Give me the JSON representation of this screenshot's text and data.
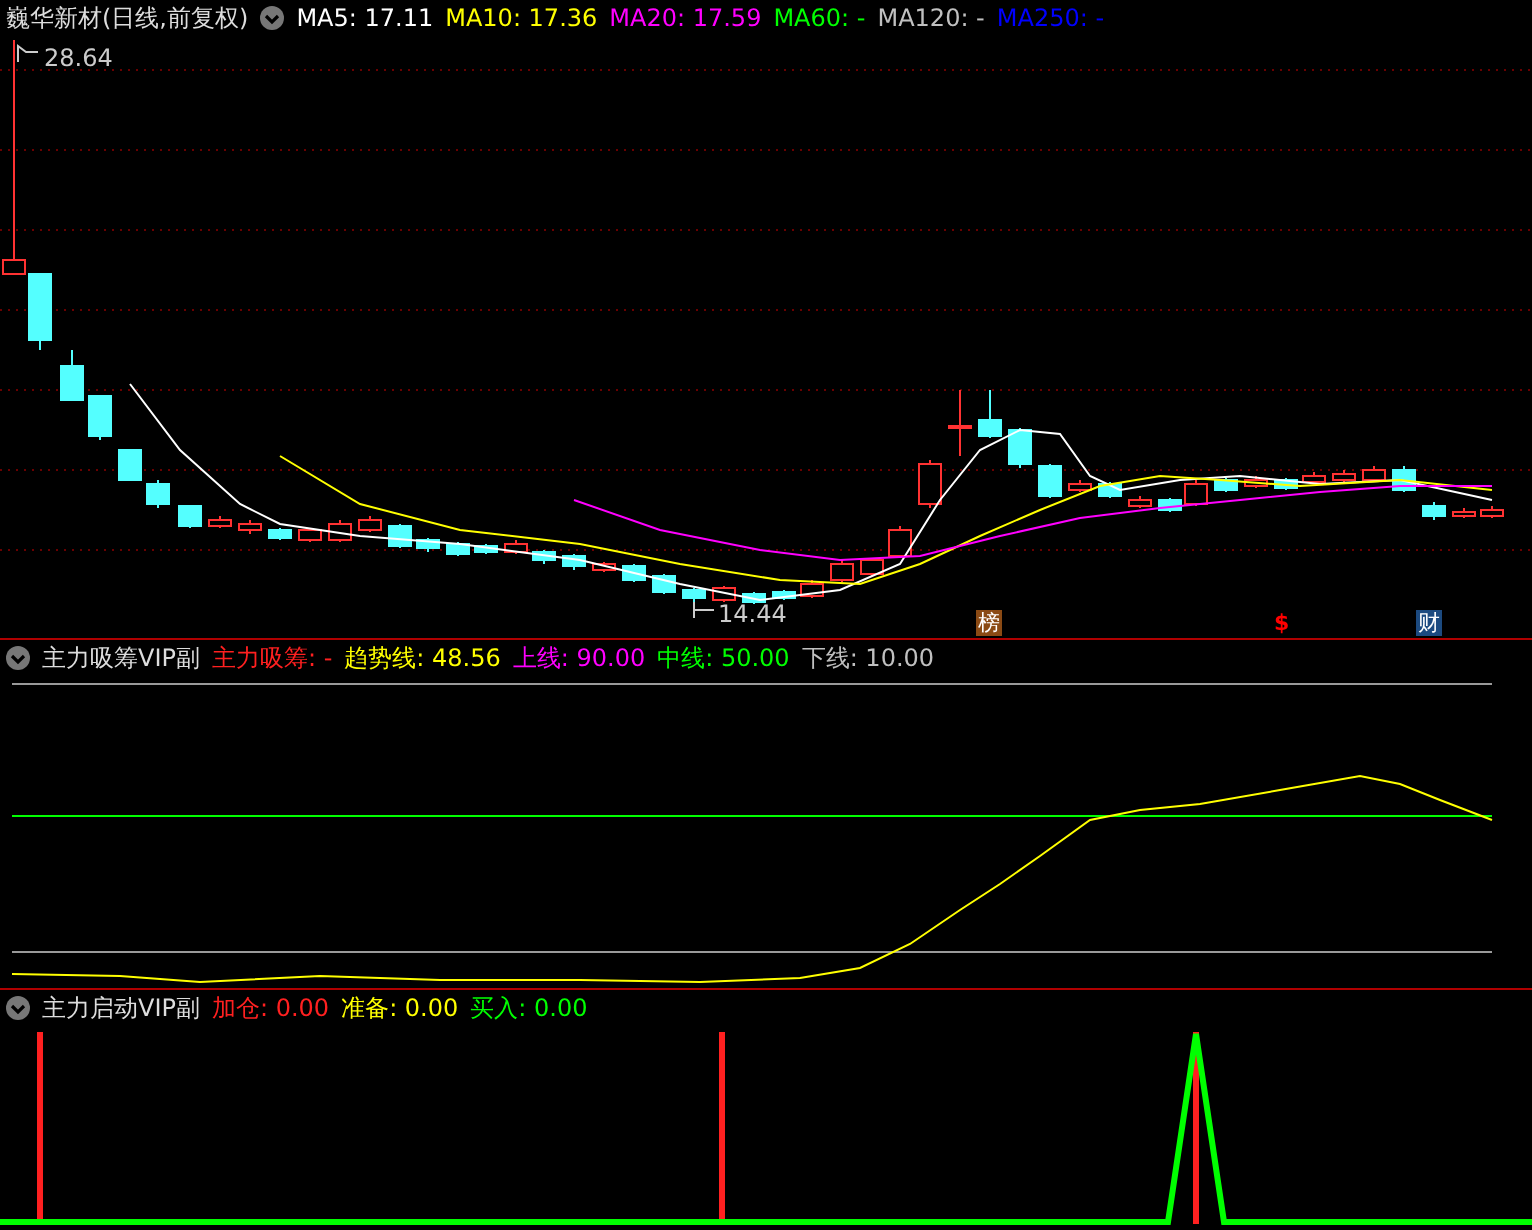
{
  "main_panel": {
    "title": "巍华新材(日线,前复权)",
    "legends": [
      {
        "label": "MA5: 17.11",
        "color": "#ffffff"
      },
      {
        "label": "MA10: 17.36",
        "color": "#ffff00"
      },
      {
        "label": "MA20: 17.59",
        "color": "#ff00ff"
      },
      {
        "label": "MA60: -",
        "color": "#00ff00"
      },
      {
        "label": "MA120: -",
        "color": "#c0c0c0"
      },
      {
        "label": "MA250: -",
        "color": "#0000ff"
      }
    ],
    "high_label": "28.64",
    "low_label": "14.44",
    "markers": [
      {
        "text": "榜",
        "color": "#8b4a14"
      },
      {
        "text": "$",
        "color": "#ff0000"
      },
      {
        "text": "财",
        "color": "#1c4a80"
      }
    ]
  },
  "indicator_panels": [
    {
      "title": "主力吸筹VIP副",
      "legends": [
        {
          "label": "主力吸筹: -",
          "color": "#ff2020"
        },
        {
          "label": "趋势线: 48.56",
          "color": "#ffff00"
        },
        {
          "label": "上线: 90.00",
          "color": "#ff00ff"
        },
        {
          "label": "中线: 50.00",
          "color": "#00ff00"
        },
        {
          "label": "下线: 10.00",
          "color": "#c0c0c0"
        }
      ]
    },
    {
      "title": "主力启动VIP副",
      "legends": [
        {
          "label": "加仓: 0.00",
          "color": "#ff2020"
        },
        {
          "label": "准备: 0.00",
          "color": "#ffff00"
        },
        {
          "label": "买入: 0.00",
          "color": "#00ff00"
        }
      ]
    }
  ]
}
